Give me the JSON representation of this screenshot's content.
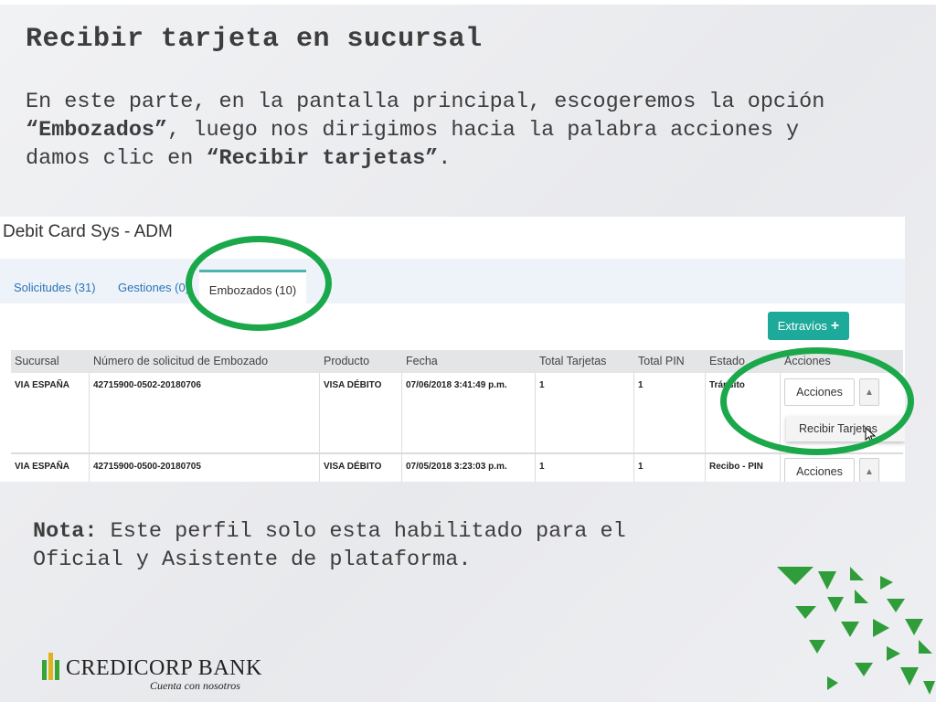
{
  "slide": {
    "title": "Recibir tarjeta en sucursal",
    "description": {
      "p1": "En este parte, en la pantalla principal, escogeremos la opción ",
      "b1": "“Embozados”",
      "p2": ", luego nos dirigimos hacia la palabra acciones y damos clic en ",
      "b2": "“Recibir tarjetas”",
      "p3": "."
    },
    "note": {
      "label": "Nota:",
      "text": " Este perfil solo esta habilitado para el Oficial y Asistente de plataforma."
    }
  },
  "app": {
    "title": "Debit Card Sys - ADM",
    "tabs": [
      {
        "label": "Solicitudes (31)"
      },
      {
        "label": "Gestiones (0)"
      },
      {
        "label": "Embozados (10)"
      }
    ],
    "extravios_label": "Extravíos",
    "table": {
      "headers": [
        "Sucursal",
        "Número de solicitud de Embozado",
        "Producto",
        "Fecha",
        "Total Tarjetas",
        "Total PIN",
        "Estado",
        "Acciones"
      ],
      "rows": [
        {
          "sucursal": "VIA ESPAÑA",
          "numero": "42715900-0502-20180706",
          "producto": "VISA DÉBITO",
          "fecha": "07/06/2018 3:41:49 p.m.",
          "total_tarjetas": "1",
          "total_pin": "1",
          "estado": "Tránsito"
        },
        {
          "sucursal": "VIA ESPAÑA",
          "numero": "42715900-0500-20180705",
          "producto": "VISA DÉBITO",
          "fecha": "07/05/2018 3:23:03 p.m.",
          "total_tarjetas": "1",
          "total_pin": "1",
          "estado": "Recibo - PIN"
        }
      ]
    },
    "acciones_label": "Acciones",
    "dropdown_item": "Recibir Tarjetas"
  },
  "logo": {
    "name": "CREDICORP BANK",
    "tagline": "Cuenta con nosotros"
  },
  "colors": {
    "highlight": "#1aa84b",
    "button_teal": "#1eaa9b",
    "tab_link": "#2a74b8",
    "brand_green": "#3aa335"
  }
}
